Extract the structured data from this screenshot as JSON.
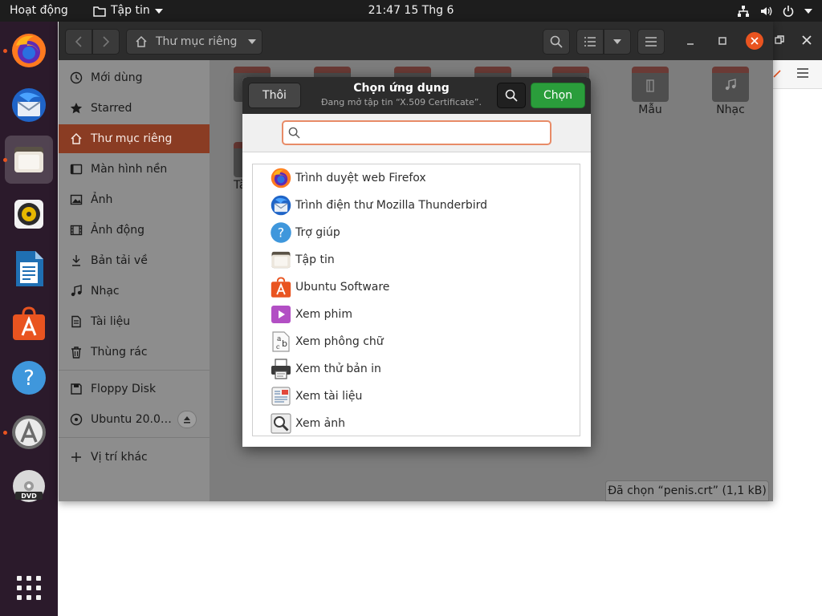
{
  "topbar": {
    "activities": "Hoạt động",
    "app_menu": "Tập tin",
    "clock": "21:47  15 Thg 6"
  },
  "dock": {
    "items": [
      {
        "name": "firefox",
        "icon": "firefox-icon",
        "running": true
      },
      {
        "name": "thunderbird",
        "icon": "thunderbird-icon",
        "running": false
      },
      {
        "name": "files",
        "icon": "files-icon",
        "running": true,
        "active": true
      },
      {
        "name": "rhythmbox",
        "icon": "rhythmbox-icon",
        "running": false
      },
      {
        "name": "writer",
        "icon": "libreoffice-writer-icon",
        "running": false
      },
      {
        "name": "ubuntu-software",
        "icon": "ubuntu-software-icon",
        "running": false
      },
      {
        "name": "help",
        "icon": "help-icon",
        "running": false
      },
      {
        "name": "software-updater",
        "icon": "software-updater-icon",
        "running": true
      },
      {
        "name": "dvd",
        "icon": "dvd-icon",
        "running": false
      },
      {
        "name": "show-apps",
        "icon": "app-grid-icon",
        "running": false
      }
    ]
  },
  "files": {
    "path": "Thư mục riêng",
    "sidebar": {
      "items": [
        {
          "label": "Mới dùng",
          "icon": "clock-icon"
        },
        {
          "label": "Starred",
          "icon": "star-icon"
        },
        {
          "label": "Thư mục riêng",
          "icon": "home-icon",
          "selected": true
        },
        {
          "label": "Màn hình nền",
          "icon": "desktop-icon"
        },
        {
          "label": "Ảnh",
          "icon": "pictures-icon"
        },
        {
          "label": "Ảnh động",
          "icon": "videos-icon"
        },
        {
          "label": "Bản tải về",
          "icon": "download-icon"
        },
        {
          "label": "Nhạc",
          "icon": "music-icon"
        },
        {
          "label": "Tài liệu",
          "icon": "documents-icon"
        },
        {
          "label": "Thùng rác",
          "icon": "trash-icon"
        }
      ],
      "devices": [
        {
          "label": "Floppy Disk",
          "icon": "floppy-icon"
        },
        {
          "label": "Ubuntu 20.0…",
          "icon": "disc-icon"
        }
      ],
      "other_locations": "Vị trí khác"
    },
    "folders": [
      {
        "label": "Mẫu"
      },
      {
        "label": "Nhạc"
      },
      {
        "label": "Tà"
      }
    ],
    "status": "Đã chọn “penis.crt” (1,1 kB)"
  },
  "dialog": {
    "title": "Chọn ứng dụng",
    "subtitle": "Đang mở tập tin “X.509 Certificate”.",
    "cancel_label": "Thôi",
    "select_label": "Chọn",
    "search_value": "",
    "apps": [
      {
        "label": "Trình duyệt web Firefox",
        "icon": "firefox-icon"
      },
      {
        "label": "Trình điện thư Mozilla Thunderbird",
        "icon": "thunderbird-icon"
      },
      {
        "label": "Trợ giúp",
        "icon": "help-icon"
      },
      {
        "label": "Tập tin",
        "icon": "files-icon"
      },
      {
        "label": "Ubuntu Software",
        "icon": "ubuntu-software-icon"
      },
      {
        "label": "Xem phim",
        "icon": "videos-player-icon"
      },
      {
        "label": "Xem phông chữ",
        "icon": "font-viewer-icon"
      },
      {
        "label": "Xem thử bản in",
        "icon": "print-preview-icon"
      },
      {
        "label": "Xem tài liệu",
        "icon": "document-viewer-icon"
      },
      {
        "label": "Xem ảnh",
        "icon": "image-viewer-icon"
      }
    ]
  },
  "colors": {
    "accent": "#e95420",
    "select_button": "#2a9d3b",
    "topbar": "#1d1d1d",
    "dock": "#2b1a2b"
  }
}
